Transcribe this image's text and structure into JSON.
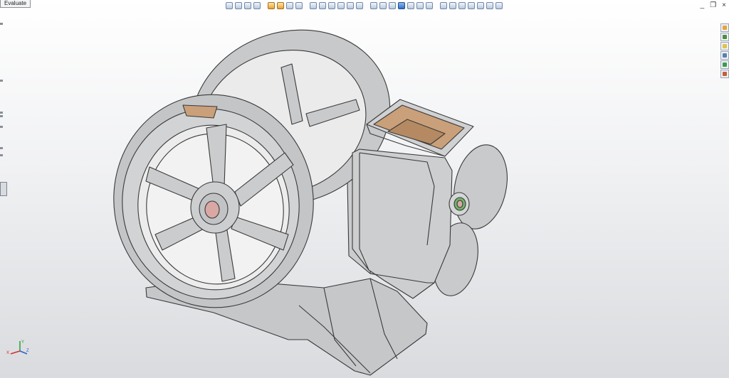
{
  "window": {
    "tab_label": "Evaluate",
    "minimize_glyph": "_",
    "restore_glyph": "❐",
    "close_glyph": "×"
  },
  "heads_up_toolbar": {
    "buttons": [
      {
        "name": "zoom-to-fit-icon",
        "style": "plain"
      },
      {
        "name": "zoom-to-area-icon",
        "style": "plain"
      },
      {
        "name": "previous-view-icon",
        "style": "plain"
      },
      {
        "name": "rotate-view-icon",
        "style": "plain"
      },
      {
        "name": "pan-icon",
        "style": "orange"
      },
      {
        "name": "sketch-line-icon",
        "style": "orange"
      },
      {
        "name": "zoom-in-out-icon",
        "style": "plain"
      },
      {
        "name": "zoom-magnifier-icon",
        "style": "plain"
      },
      {
        "name": "section-view-icon",
        "style": "plain"
      },
      {
        "name": "view-orientation-icon",
        "style": "plain"
      },
      {
        "name": "display-style-icon",
        "style": "plain"
      },
      {
        "name": "hide-show-items-icon",
        "style": "plain"
      },
      {
        "name": "edit-appearance-icon",
        "style": "plain"
      },
      {
        "name": "apply-scene-icon",
        "style": "plain"
      },
      {
        "name": "wireframe-icon",
        "style": "plain"
      },
      {
        "name": "hidden-lines-visible-icon",
        "style": "plain"
      },
      {
        "name": "hidden-lines-removed-icon",
        "style": "plain"
      },
      {
        "name": "shaded-with-edges-icon",
        "style": "active"
      },
      {
        "name": "shaded-icon",
        "style": "plain"
      },
      {
        "name": "draft-quality-hlr-icon",
        "style": "plain"
      },
      {
        "name": "perspective-icon",
        "style": "plain"
      },
      {
        "name": "shadows-icon",
        "style": "plain"
      },
      {
        "name": "isometric-view-icon",
        "style": "plain"
      },
      {
        "name": "front-view-icon",
        "style": "plain"
      },
      {
        "name": "top-view-icon",
        "style": "plain"
      },
      {
        "name": "right-view-icon",
        "style": "plain"
      },
      {
        "name": "trimetric-view-icon",
        "style": "plain"
      },
      {
        "name": "dimetric-view-icon",
        "style": "plain"
      }
    ]
  },
  "task_pane": {
    "buttons": [
      {
        "name": "solidworks-resources-icon",
        "color": "#e8a23b"
      },
      {
        "name": "design-library-icon",
        "color": "#4a8f3c"
      },
      {
        "name": "file-explorer-icon",
        "color": "#e3c14a"
      },
      {
        "name": "view-palette-icon",
        "color": "#5a7fb0"
      },
      {
        "name": "appearances-scenes-icon",
        "color": "#3b9b4a"
      },
      {
        "name": "custom-properties-icon",
        "color": "#c85c3a"
      }
    ]
  },
  "colors": {
    "part_gray": "#c9cacc",
    "part_edge": "#3a3a3a",
    "hopper_inside": "#c9a07a",
    "cutout_pink": "#d9a8a4",
    "window_green": "#6fb56a"
  },
  "triad": {
    "x_label": "X",
    "y_label": "Y",
    "z_label": "Z"
  }
}
